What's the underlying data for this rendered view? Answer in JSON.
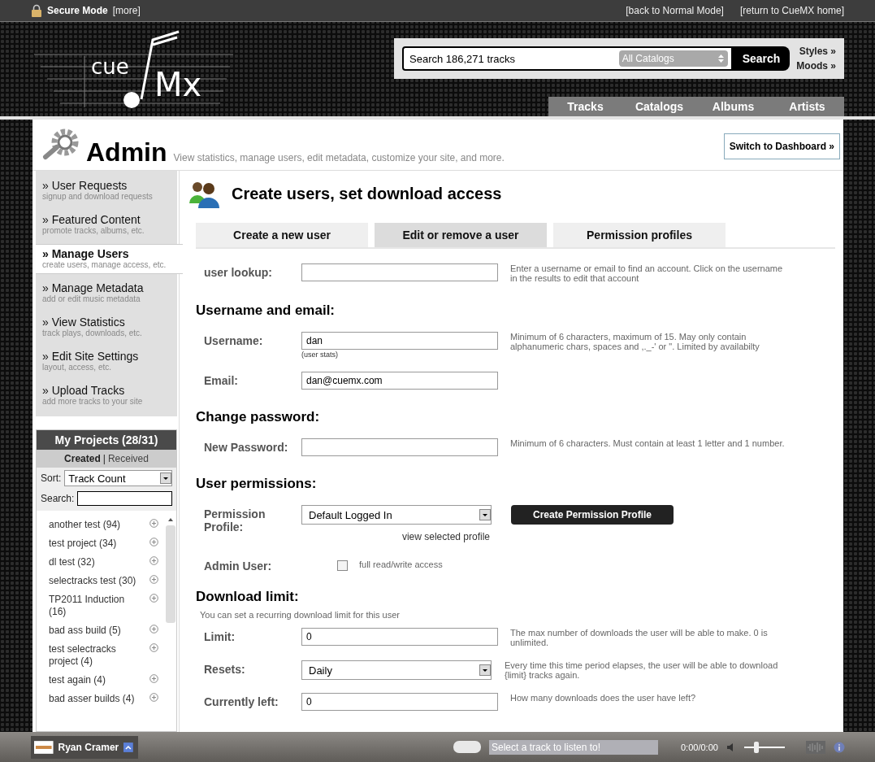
{
  "top_bar": {
    "secure_label": "Secure Mode",
    "more_link": "[more]",
    "links": [
      "[back to Normal Mode]",
      "[return to CueMX home]"
    ]
  },
  "logo": {
    "word_1": "cue",
    "word_2": "Mx"
  },
  "search": {
    "value": "Search 186,271 tracks",
    "catalog": "All Catalogs",
    "button": "Search",
    "links": [
      "Styles »",
      "Moods »"
    ]
  },
  "nav": [
    {
      "label": "Tracks"
    },
    {
      "label": "Catalogs"
    },
    {
      "label": "Albums"
    },
    {
      "label": "Artists"
    }
  ],
  "admin": {
    "title": "Admin",
    "subtitle": "View statistics, manage users, edit metadata, customize your site, and more.",
    "dashboard_button": "Switch to Dashboard »"
  },
  "sidebar_menu": [
    {
      "title": "» User Requests",
      "subtitle": "signup and download requests",
      "selected": false
    },
    {
      "title": "» Featured Content",
      "subtitle": "promote tracks, albums, etc.",
      "selected": false
    },
    {
      "title": "» Manage Users",
      "subtitle": "create users, manage access, etc.",
      "selected": true
    },
    {
      "title": "» Manage Metadata",
      "subtitle": "add or edit music metadata",
      "selected": false
    },
    {
      "title": "» View Statistics",
      "subtitle": "track plays, downloads, etc.",
      "selected": false
    },
    {
      "title": "» Edit Site Settings",
      "subtitle": "layout, access, etc.",
      "selected": false
    },
    {
      "title": "» Upload Tracks",
      "subtitle": "add more tracks to your site",
      "selected": false
    }
  ],
  "projects": {
    "title": "My Projects (28/31)",
    "tabs": [
      {
        "label": "Created",
        "selected": true
      },
      {
        "label": "Received",
        "selected": false
      }
    ],
    "separator": "|",
    "sort_label": "Sort:",
    "sort_value": "Track Count",
    "search_label": "Search:",
    "items": [
      "another test (94)",
      "test project (34)",
      "dl test (32)",
      "selectracks test (30)",
      "TP2011 Induction (16)",
      "bad ass build (5)",
      "test selectracks project (4)",
      "test again (4)",
      "bad asser builds (4)"
    ]
  },
  "section": {
    "title": "Create users, set download access",
    "tabs": [
      {
        "label": "Create a new user",
        "selected": false
      },
      {
        "label": "Edit or remove a user",
        "selected": true
      },
      {
        "label": "Permission profiles",
        "selected": false
      }
    ]
  },
  "form": [
    {
      "kind": "field",
      "label": "user lookup:",
      "hint": "Enter a username or email to find an account. Click on the username in the results to edit that account"
    },
    {
      "kind": "heading",
      "text": "Username and email:"
    },
    {
      "kind": "field",
      "label": "Username:",
      "value": "dan",
      "sublink": "(user stats)",
      "hint": "Minimum of 6 characters, maximum of 15. May only contain alphanumeric chars, spaces and ,._-' or \". Limited by availabilty"
    },
    {
      "kind": "field",
      "label": "Email:",
      "value": "dan@cuemx.com"
    },
    {
      "kind": "heading",
      "text": "Change password:"
    },
    {
      "kind": "field",
      "label": "New Password:",
      "hint": "Minimum of 6 characters. Must contain at least 1 letter and 1 number."
    },
    {
      "kind": "heading",
      "text": "User permissions:"
    },
    {
      "kind": "select",
      "label": "Permission Profile:",
      "value": "Default Logged In",
      "sublink": "view selected profile",
      "button": "Create Permission Profile"
    },
    {
      "kind": "checkbox",
      "label": "Admin User:",
      "checked": false,
      "text": "full read/write access"
    },
    {
      "kind": "heading",
      "text": "Download limit:"
    },
    {
      "kind": "note",
      "text": "You can set a recurring download limit for this user"
    },
    {
      "kind": "field",
      "label": "Limit:",
      "value": "0",
      "hint": "The max number of downloads the user will be able to make. 0 is unlimited."
    },
    {
      "kind": "select",
      "label": "Resets:",
      "value": "Daily",
      "hint": "Every time this time period elapses, the user will be able to download {limit} tracks again."
    },
    {
      "kind": "field",
      "label": "Currently left:",
      "value": "0",
      "hint": "How many downloads does the user have left?"
    }
  ],
  "player": {
    "user": "Ryan Cramer",
    "track_text": "Select a track to listen to!",
    "time": "0:00/0:00",
    "volume": {
      "level": 0.3
    }
  }
}
